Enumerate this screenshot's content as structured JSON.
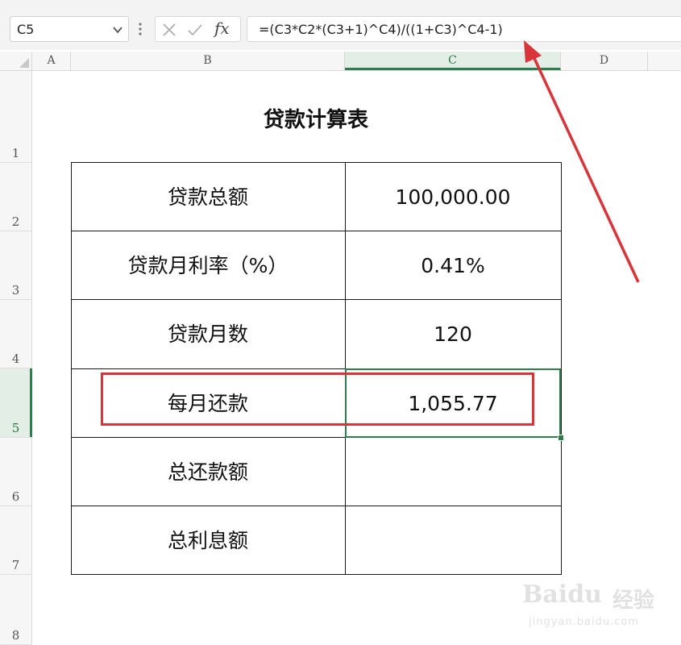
{
  "formula_bar": {
    "name_box": "C5",
    "fx_label": "fx",
    "formula": "=(C3*C2*(C3+1)^C4)/((1+C3)^C4-1)"
  },
  "columns": [
    "A",
    "B",
    "C",
    "D"
  ],
  "rows": [
    "1",
    "2",
    "3",
    "4",
    "5",
    "6",
    "7",
    "8"
  ],
  "sheet": {
    "title": "贷款计算表",
    "table": [
      {
        "label": "贷款总额",
        "value": "100,000.00"
      },
      {
        "label": "贷款月利率（%）",
        "value": "0.41%"
      },
      {
        "label": "贷款月数",
        "value": "120"
      },
      {
        "label": "每月还款",
        "value": "1,055.77"
      },
      {
        "label": "总还款额",
        "value": ""
      },
      {
        "label": "总利息额",
        "value": ""
      }
    ]
  },
  "watermark": {
    "logo": "Baidu",
    "cn": "经验",
    "url": "jingyan.baidu.com"
  },
  "colors": {
    "accent": "#2e7d4a",
    "highlight": "#d9343a"
  }
}
